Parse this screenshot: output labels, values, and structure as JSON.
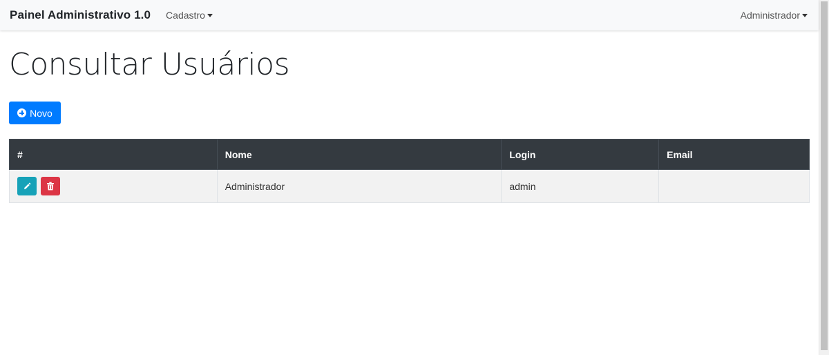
{
  "navbar": {
    "brand": "Painel Administrativo 1.0",
    "menu_cadastro": "Cadastro",
    "menu_user": "Administrador"
  },
  "page": {
    "title": "Consultar Usuários",
    "new_button_label": "Novo"
  },
  "table": {
    "headers": [
      "#",
      "Nome",
      "Login",
      "Email"
    ],
    "rows": [
      {
        "nome": "Administrador",
        "login": "admin",
        "email": ""
      }
    ]
  },
  "icons": {
    "new_button": "plus-circle-icon",
    "edit_button": "pencil-icon",
    "delete_button": "trash-icon"
  },
  "colors": {
    "primary": "#007bff",
    "info": "#17a2b8",
    "danger": "#dc3545",
    "table_header": "#343a40",
    "navbar_bg": "#f8f9fa"
  }
}
